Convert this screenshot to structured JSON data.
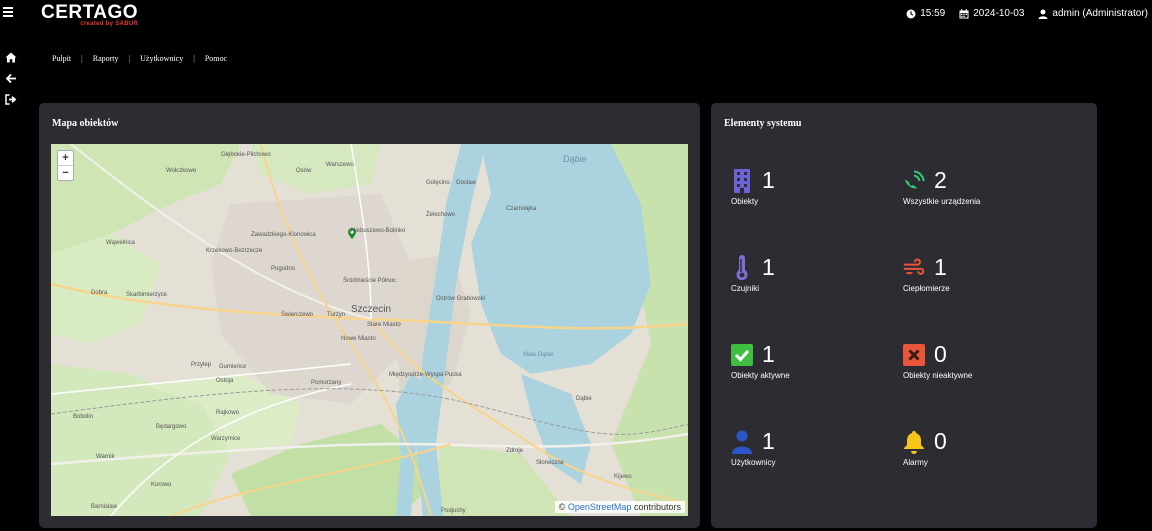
{
  "header": {
    "logo_main": "CERTAGO",
    "logo_sub": "created by SABUR",
    "time": "15:59",
    "date": "2024-10-03",
    "user": "admin (Administrator)"
  },
  "breadcrumb": [
    "Pulpit",
    "Raporty",
    "Użytkownicy",
    "Pomoc"
  ],
  "map_panel": {
    "title": "Mapa obiektów",
    "zoom_in": "+",
    "zoom_out": "−",
    "attribution_prefix": "©",
    "attribution_link": "OpenStreetMap",
    "attribution_suffix": "contributors",
    "city_label": "Szczecin",
    "lake_label": "Dąbie",
    "labels": [
      "Głębokie-Pilchowo",
      "Warszewo",
      "Wołczkowo",
      "Osów",
      "Gocław",
      "Golęcino",
      "Żelechowo",
      "Niebuszewo",
      "Zawadzkiego-Klonowica",
      "Krzekowo-Bezrzecze",
      "Pogodno",
      "Wąwelnica",
      "Dobra",
      "Skarbimierzyce",
      "Śródmieście Północ",
      "Turzyn",
      "Świerczewo",
      "Stare Miasto",
      "Nowe Miasto",
      "Pomorzany",
      "Gumieńce",
      "Przylep",
      "Ostoja",
      "Bobolin",
      "Rajkowo",
      "Będargowo",
      "Warzymice",
      "Warnik",
      "Kurowo",
      "Barnisław",
      "Międzyodrze-Wyspa Pucka",
      "Zdroje",
      "Słoneczne",
      "Kijewo",
      "Dąbie",
      "Podjuchy",
      "Mała Dąbie",
      "Ostrów Grabowski",
      "Czarnołęka",
      "Niebuszewo-Bolinko"
    ],
    "marker_icon": "map-pin-icon"
  },
  "system_panel": {
    "title": "Elementy systemu",
    "stats": [
      {
        "value": "1",
        "label": "Obiekty",
        "icon": "building-icon",
        "color": "#6b63d6"
      },
      {
        "value": "2",
        "label": "Wszystkie urządzenia",
        "icon": "satellite-dish-icon",
        "color": "#2ecc71"
      },
      {
        "value": "1",
        "label": "Czujniki",
        "icon": "thermometer-icon",
        "color": "#7e6fd8"
      },
      {
        "value": "1",
        "label": "Ciepłomierze",
        "icon": "wind-icon",
        "color": "#e8553a"
      },
      {
        "value": "1",
        "label": "Obiekty aktywne",
        "icon": "check-square-icon",
        "color": "#3fbf3f"
      },
      {
        "value": "0",
        "label": "Obiekty nieaktywne",
        "icon": "x-square-icon",
        "color": "#e8553a"
      },
      {
        "value": "1",
        "label": "Użytkownicy",
        "icon": "user-icon",
        "color": "#2b56c7"
      },
      {
        "value": "0",
        "label": "Alarmy",
        "icon": "bell-icon",
        "color": "#f5c518"
      }
    ]
  }
}
